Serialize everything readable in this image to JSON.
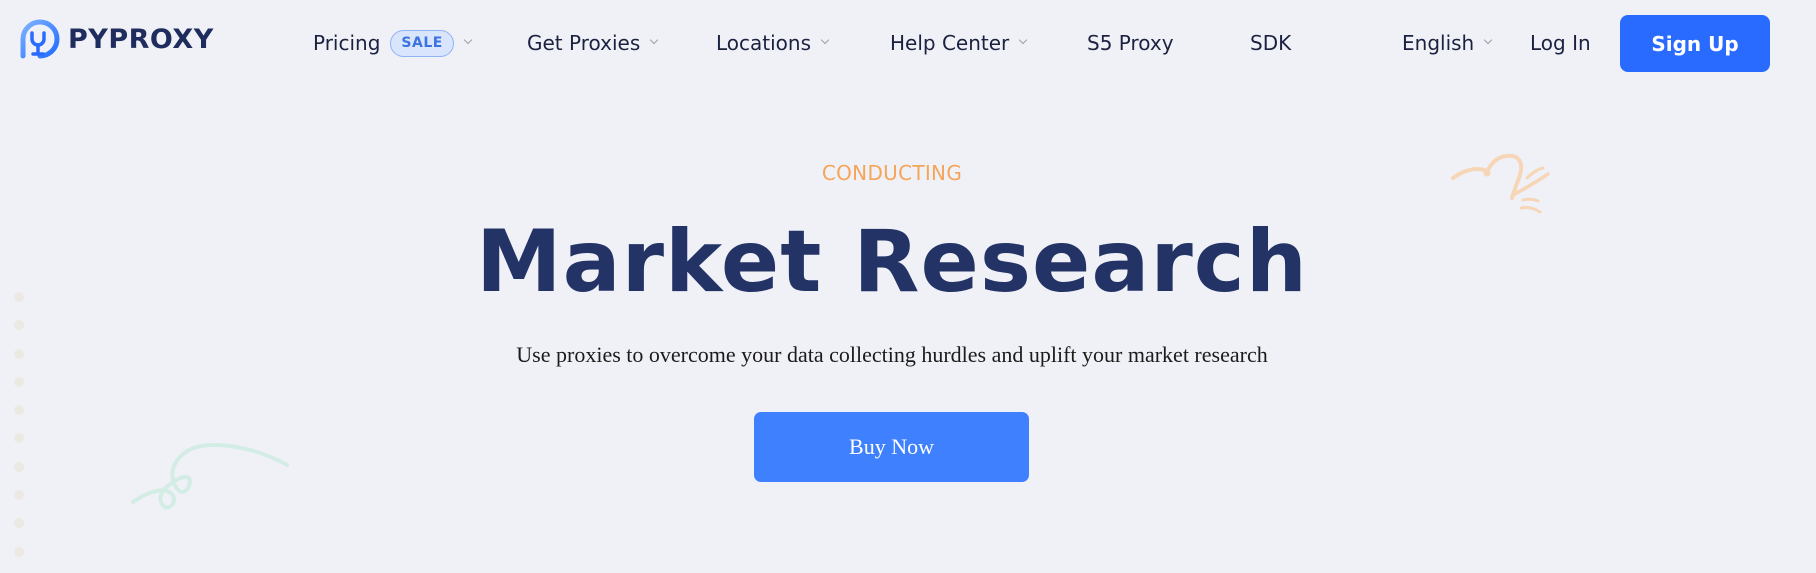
{
  "brand": {
    "name": "PYPROXY",
    "logo_icon": "pyproxy-logo-icon"
  },
  "nav": {
    "items": [
      {
        "label": "Pricing",
        "badge": "SALE",
        "has_dropdown": true
      },
      {
        "label": "Get Proxies",
        "has_dropdown": true
      },
      {
        "label": "Locations",
        "has_dropdown": true
      },
      {
        "label": "Help Center",
        "has_dropdown": true
      },
      {
        "label": "S5 Proxy",
        "has_dropdown": false
      },
      {
        "label": "SDK",
        "has_dropdown": false
      }
    ],
    "language": {
      "label": "English",
      "icon": "chevron-down-icon"
    },
    "login_label": "Log In",
    "signup_label": "Sign Up"
  },
  "hero": {
    "eyebrow": "CONDUCTING",
    "title": "Market Research",
    "subtitle": "Use proxies to overcome your data collecting hurdles and uplift your market research",
    "cta_label": "Buy Now"
  },
  "colors": {
    "background": "#f0f1f7",
    "primary": "#2a6bff",
    "cta": "#3f80ff",
    "title": "#233366",
    "eyebrow": "#f5a55a",
    "sale_badge_bg": "#d9e5fc",
    "sale_badge_text": "#3b73e0"
  },
  "decorations": [
    "orange-squiggle",
    "teal-loop-squiggle",
    "dotted-column"
  ]
}
